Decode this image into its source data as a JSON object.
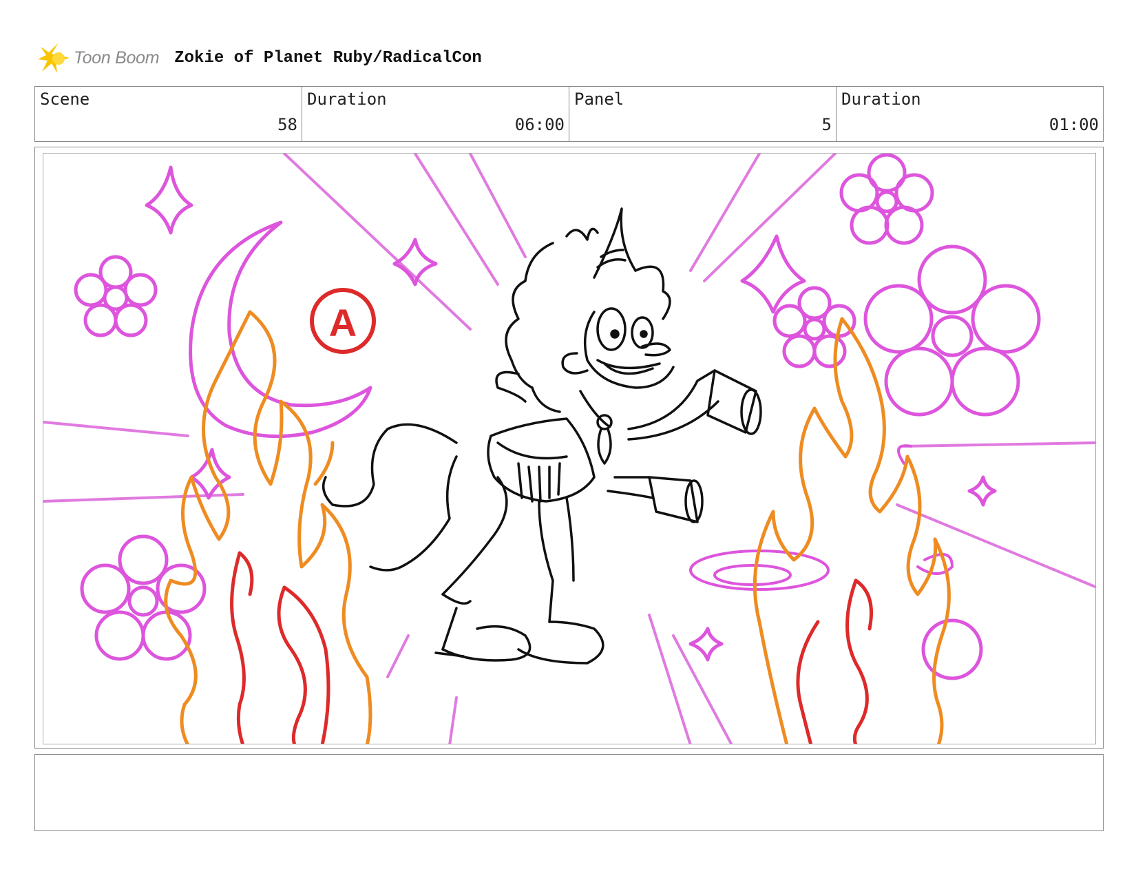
{
  "header": {
    "logo_text": "Toon Boom",
    "project_title": "Zokie of Planet Ruby/RadicalCon"
  },
  "info": {
    "scene_label": "Scene",
    "scene_value": "58",
    "scene_duration_label": "Duration",
    "scene_duration_value": "06:00",
    "panel_label": "Panel",
    "panel_value": "5",
    "panel_duration_label": "Duration",
    "panel_duration_value": "01:00"
  },
  "drawing": {
    "marker_letter": "A"
  },
  "notes": {
    "text": ""
  },
  "colors": {
    "magenta": "#dd55dd",
    "orange": "#ee8c22",
    "red": "#dd2a2a",
    "ink": "#111111",
    "logo_yellow": "#f7c600"
  }
}
